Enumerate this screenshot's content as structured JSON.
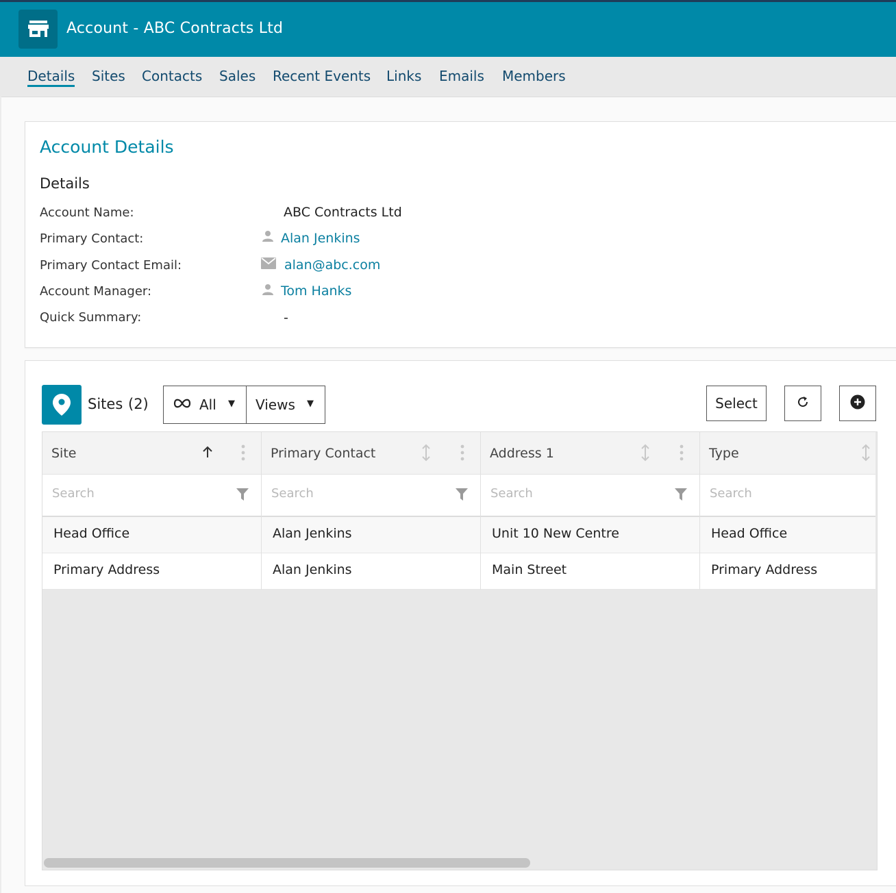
{
  "header": {
    "title": "Account - ABC Contracts Ltd",
    "icon": "store-icon",
    "bg_color": "#0089a8"
  },
  "tabs": [
    {
      "label": "Details",
      "active": true
    },
    {
      "label": "Sites"
    },
    {
      "label": "Contacts"
    },
    {
      "label": "Sales"
    },
    {
      "label": "Recent Events"
    },
    {
      "label": "Links"
    },
    {
      "label": "Emails"
    },
    {
      "label": "Members"
    }
  ],
  "account_details": {
    "title": "Account Details",
    "section": "Details",
    "fields": {
      "account_name": {
        "label": "Account Name:",
        "value": "ABC Contracts Ltd"
      },
      "primary_contact": {
        "label": "Primary Contact:",
        "value": "Alan Jenkins",
        "icon": "person-icon"
      },
      "primary_contact_email": {
        "label": "Primary Contact Email:",
        "value": "alan@abc.com",
        "icon": "mail-icon"
      },
      "account_manager": {
        "label": "Account Manager:",
        "value": "Tom Hanks",
        "icon": "person-icon"
      },
      "quick_summary": {
        "label": "Quick Summary:",
        "value": "-"
      }
    }
  },
  "sites_panel": {
    "title": "Sites",
    "count": "(2)",
    "filter_label": "All",
    "views_label": "Views",
    "select_label": "Select",
    "columns": [
      {
        "label": "Site",
        "sort": "ascending",
        "search_placeholder": "Search"
      },
      {
        "label": "Primary Contact",
        "sort": "none",
        "search_placeholder": "Search"
      },
      {
        "label": "Address 1",
        "sort": "none",
        "search_placeholder": "Search"
      },
      {
        "label": "Type",
        "sort": "none",
        "search_placeholder": "Search"
      }
    ],
    "rows": [
      {
        "site": "Head Office",
        "primary_contact": "Alan Jenkins",
        "address1": "Unit 10 New Centre",
        "type": "Head Office"
      },
      {
        "site": "Primary Address",
        "primary_contact": "Alan Jenkins",
        "address1": "Main Street",
        "type": "Primary Address"
      }
    ]
  }
}
